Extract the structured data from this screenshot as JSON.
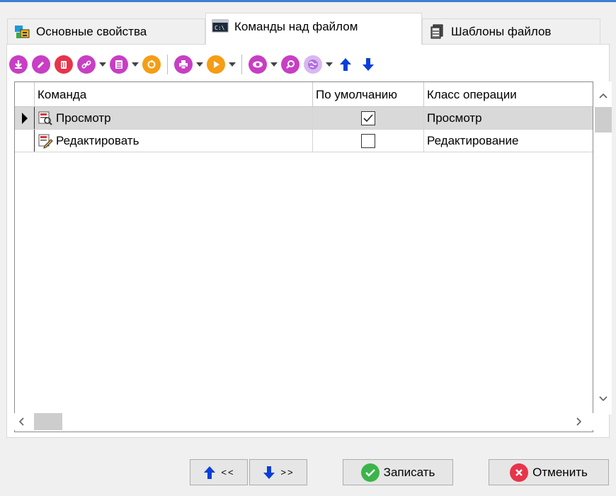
{
  "tabs": [
    {
      "label": "Основные свойства",
      "icon": "properties-icon",
      "active": false
    },
    {
      "label": "Команды над файлом",
      "icon": "console-icon",
      "active": true
    },
    {
      "label": "Шаблоны файлов",
      "icon": "templates-icon",
      "active": false
    }
  ],
  "toolbar": {
    "icons": [
      "import-icon",
      "edit-icon",
      "delete-icon",
      "link-icon",
      "document-icon",
      "refresh-icon",
      "print-icon",
      "play-icon",
      "view-icon",
      "search-icon",
      "globe-icon",
      "arrow-up-icon",
      "arrow-down-icon"
    ]
  },
  "grid": {
    "columns": [
      "Команда",
      "По умолчанию",
      "Класс операции"
    ],
    "rows": [
      {
        "command": "Просмотр",
        "default": true,
        "operation_class": "Просмотр",
        "selected": true
      },
      {
        "command": "Редактировать",
        "default": false,
        "operation_class": "Редактирование",
        "selected": false
      }
    ]
  },
  "buttons": {
    "move_up_label": "<<",
    "move_down_label": ">>",
    "save_label": "Записать",
    "cancel_label": "Отменить"
  },
  "colors": {
    "accent": "#3c7fd2",
    "toolbar_magenta": "#c83ec4",
    "toolbar_red": "#e8344a",
    "toolbar_orange": "#f59d14",
    "arrow_blue": "#0b3fd8",
    "save_green": "#3cb44a",
    "cancel_red": "#e8344a"
  }
}
